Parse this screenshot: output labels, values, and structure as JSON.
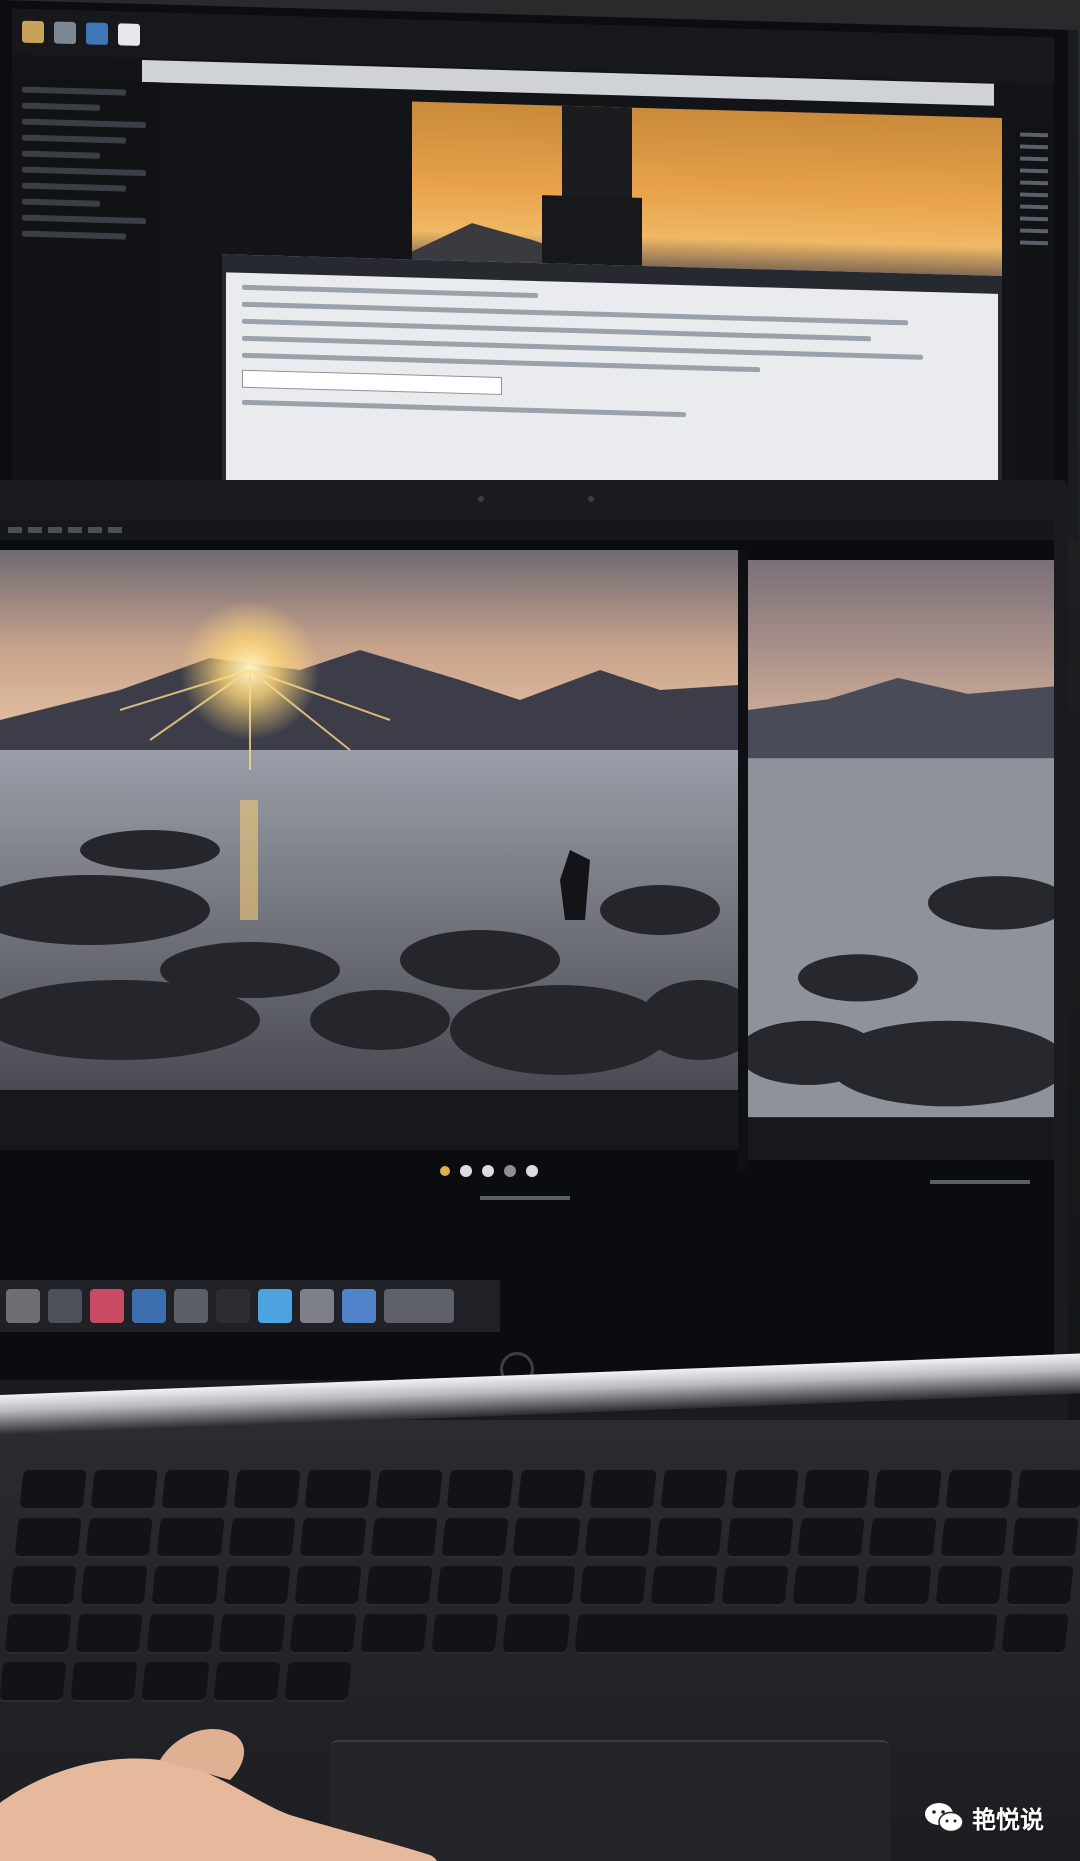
{
  "watermark": {
    "label": "艳悦说",
    "icon": "wechat-icon"
  },
  "colors": {
    "sky_top": "#6f6a73",
    "sun": "#fff1b8",
    "water": "#8a8f99",
    "rocks": "#2a2a2e",
    "deck": "#1c1d21"
  }
}
